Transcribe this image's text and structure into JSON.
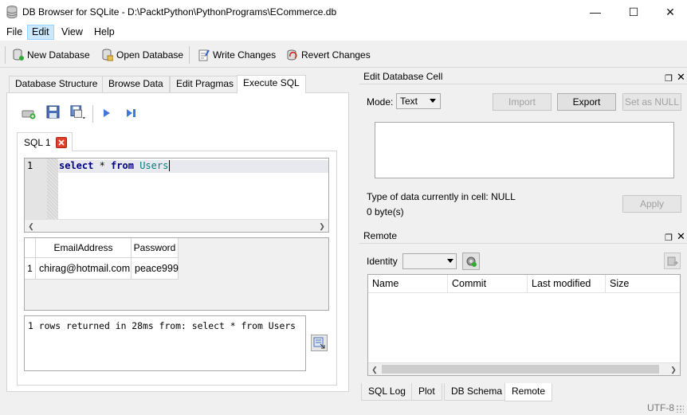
{
  "window": {
    "title": "DB Browser for SQLite - D:\\PacktPython\\PythonPrograms\\ECommerce.db",
    "minimize": "—",
    "maximize": "☐",
    "close": "✕"
  },
  "menu": {
    "file": "File",
    "edit": "Edit",
    "view": "View",
    "help": "Help"
  },
  "toolbar": {
    "new_db": "New Database",
    "open_db": "Open Database",
    "write": "Write Changes",
    "revert": "Revert Changes"
  },
  "tabs": {
    "structure": "Database Structure",
    "browse": "Browse Data",
    "pragmas": "Edit Pragmas",
    "execute": "Execute SQL"
  },
  "sql_tab": {
    "label": "SQL 1"
  },
  "editor": {
    "line_number": "1",
    "kw1": "select",
    "star": " * ",
    "kw2": "from",
    "table": "Users"
  },
  "results": {
    "headers": [
      "EmailAddress",
      "Password"
    ],
    "row_number": "1",
    "row": [
      "chirag@hotmail.com",
      "peace999"
    ]
  },
  "message": "1 rows returned in 28ms from: select * from Users",
  "edit_cell": {
    "title": "Edit Database Cell",
    "mode_label": "Mode:",
    "mode_value": "Text",
    "import": "Import",
    "export": "Export",
    "set_null": "Set as NULL",
    "type_info": "Type of data currently in cell: NULL",
    "size_info": "0 byte(s)",
    "apply": "Apply"
  },
  "remote": {
    "title": "Remote",
    "identity_label": "Identity",
    "columns": [
      "Name",
      "Commit",
      "Last modified",
      "Size"
    ]
  },
  "bottom_tabs": {
    "log": "SQL Log",
    "plot": "Plot",
    "schema": "DB Schema",
    "remote": "Remote"
  },
  "status": {
    "encoding": "UTF-8"
  },
  "colors": {
    "keyword": "#000080",
    "table_name": "#008080",
    "selection": "#cce8ff",
    "close_tab": "#e0402a"
  }
}
